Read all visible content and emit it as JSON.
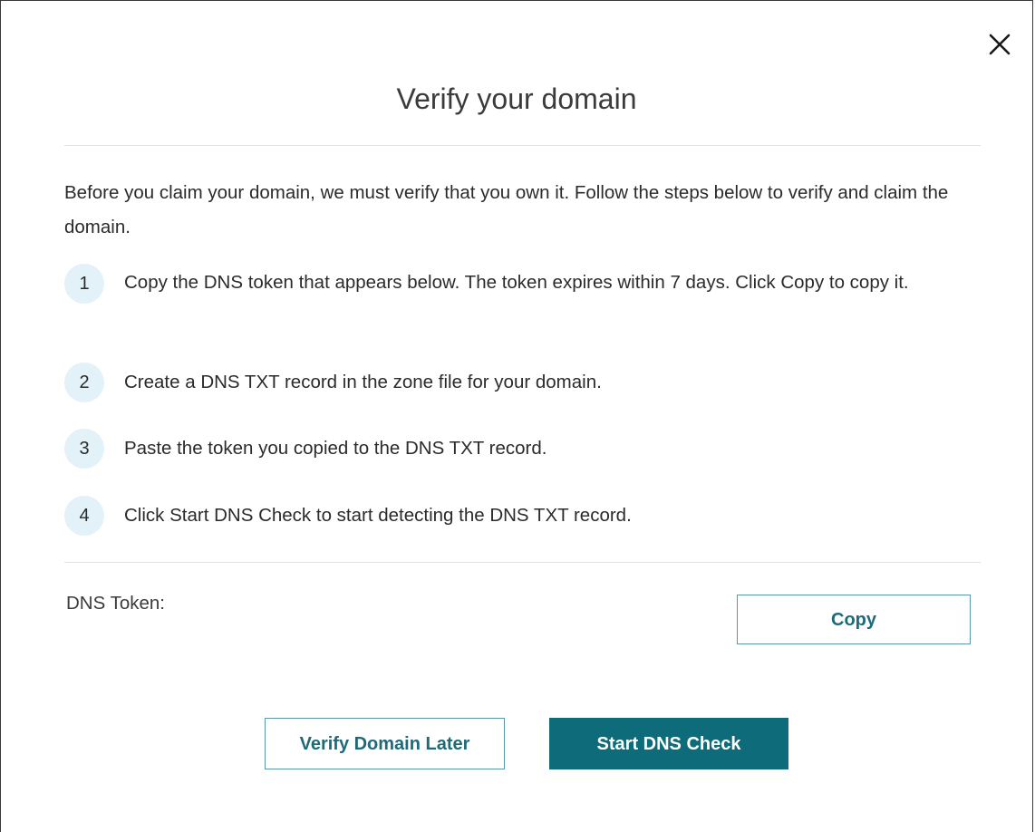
{
  "dialog": {
    "title": "Verify your domain",
    "intro": "Before you claim your domain, we must verify that you own it. Follow the steps below to verify and claim the domain.",
    "steps": [
      {
        "number": "1",
        "text": "Copy the DNS token that appears below. The token expires within 7 days. Click Copy to copy it."
      },
      {
        "number": "2",
        "text": "Create a DNS TXT record in the zone file for your domain."
      },
      {
        "number": "3",
        "text": "Paste the token you copied to the DNS TXT record."
      },
      {
        "number": "4",
        "text": "Click Start DNS Check to start detecting the DNS TXT record."
      }
    ],
    "token_label": "DNS Token:",
    "copy_label": "Copy",
    "verify_later_label": "Verify Domain Later",
    "start_check_label": "Start DNS Check",
    "close_icon": "close-icon"
  },
  "colors": {
    "primary": "#0d6b7a",
    "outline_border": "#5a9aa8",
    "outline_text": "#1d6a79",
    "step_circle": "#e3f1f8"
  }
}
